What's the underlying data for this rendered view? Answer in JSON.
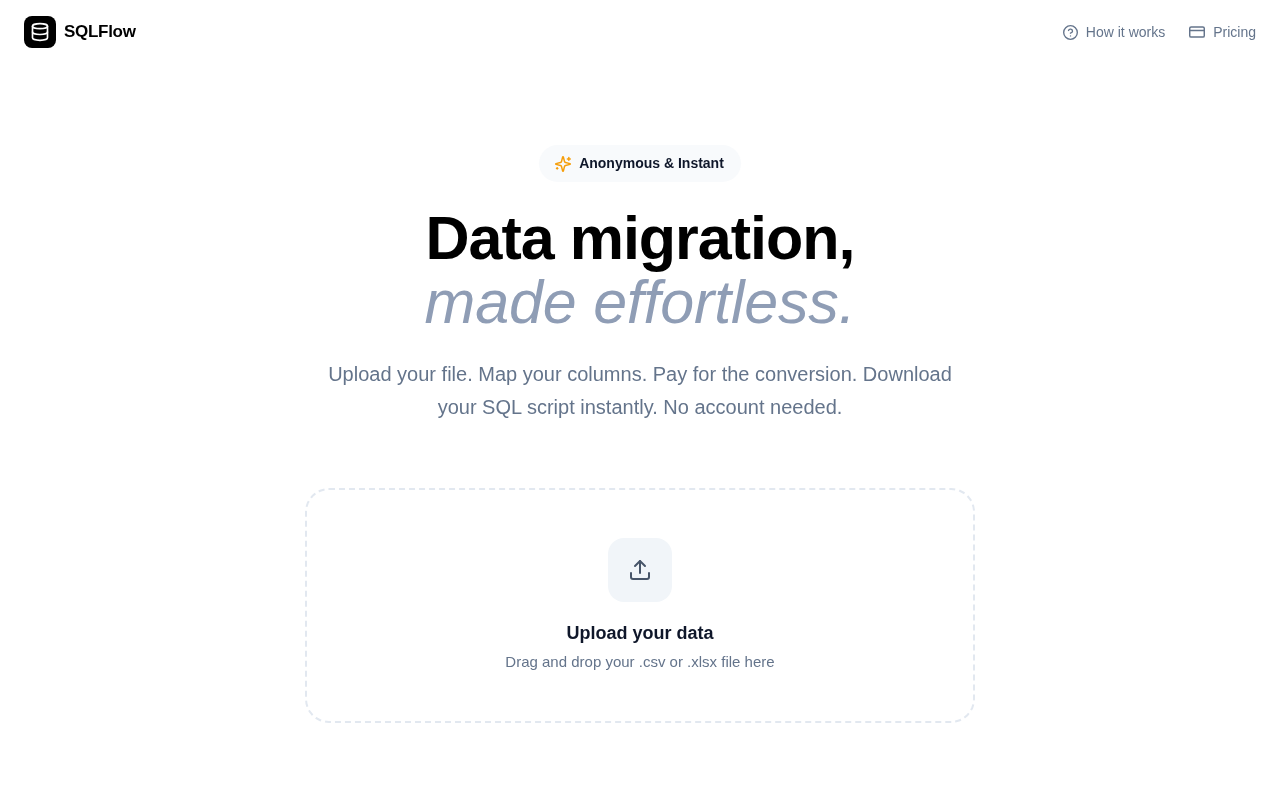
{
  "header": {
    "brand": "SQLFlow",
    "how_it_works_link": "How it works",
    "pricing_link": "Pricing"
  },
  "hero": {
    "badge": "Anonymous & Instant",
    "title_line_1": "Data migration,",
    "title_line_2": "made effortless.",
    "description": "Upload your file. Map your columns. Pay for the conversion. Download your SQL script instantly. No account needed."
  },
  "upload": {
    "title": "Upload your data",
    "hint": "Drag and drop your .csv or .xlsx file here"
  }
}
